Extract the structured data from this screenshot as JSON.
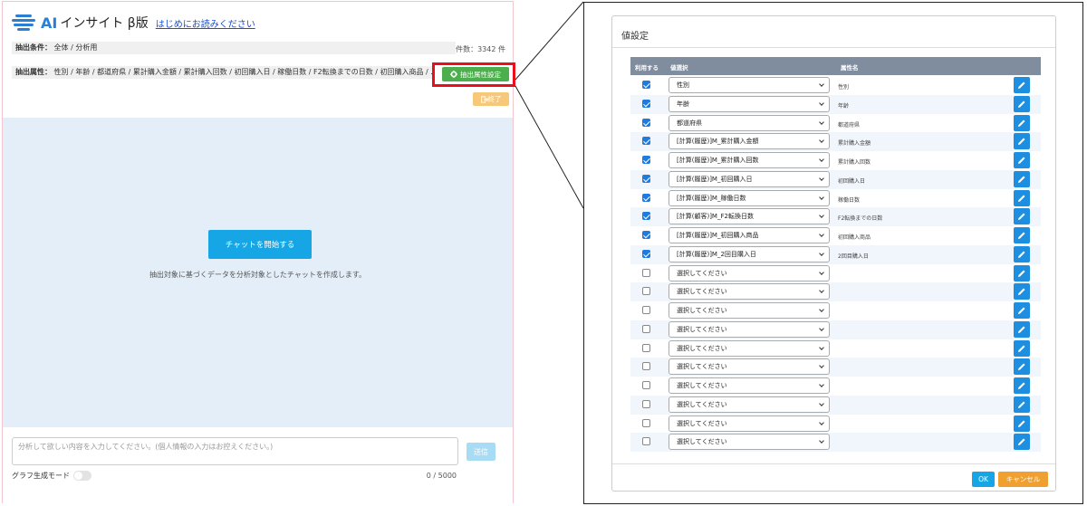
{
  "app": {
    "logo_ai": "AI",
    "logo_text": "インサイト β版",
    "readme_link": "はじめにお読みください",
    "condition_label": "抽出条件：",
    "condition_value": "全体 / 分析用",
    "count_text": "件数：3342 件",
    "attribute_label": "抽出属性：",
    "attribute_value": "性別 / 年齢 / 都道府県 / 累計購入金額 / 累計購入回数 / 初回購入日 / 稼働日数 / F2転換までの日数 / 初回購入商品 / …",
    "attribute_setting_button": "抽出属性設定",
    "end_button": "終了",
    "start_chat_button": "チャットを開始する",
    "chat_description": "抽出対象に基づくデータを分析対象としたチャットを作成します。",
    "message_placeholder": "分析して欲しい内容を入力してください。(個人情報の入力はお控えください。)",
    "send_button": "送信",
    "graph_mode_label": "グラフ生成モード",
    "char_count": "0 / 5000"
  },
  "dialog": {
    "title": "値設定",
    "headers": {
      "use": "利用する",
      "value_select": "値選択",
      "attr_name": "属性名"
    },
    "rows": [
      {
        "checked": true,
        "value": "性別",
        "attr": "性別"
      },
      {
        "checked": true,
        "value": "年齢",
        "attr": "年齢"
      },
      {
        "checked": true,
        "value": "都道府県",
        "attr": "都道府県"
      },
      {
        "checked": true,
        "value": "[計算(履歴)]M_累計購入金額",
        "attr": "累計購入金額"
      },
      {
        "checked": true,
        "value": "[計算(履歴)]M_累計購入回数",
        "attr": "累計購入回数"
      },
      {
        "checked": true,
        "value": "[計算(履歴)]M_初回購入日",
        "attr": "初回購入日"
      },
      {
        "checked": true,
        "value": "[計算(履歴)]M_稼働日数",
        "attr": "稼働日数"
      },
      {
        "checked": true,
        "value": "[計算(顧客)]M_F2転換日数",
        "attr": "F2転換までの日数"
      },
      {
        "checked": true,
        "value": "[計算(履歴)]M_初回購入商品",
        "attr": "初回購入商品"
      },
      {
        "checked": true,
        "value": "[計算(履歴)]M_2回目購入日",
        "attr": "2回目購入日"
      },
      {
        "checked": false,
        "value": "選択してください",
        "attr": ""
      },
      {
        "checked": false,
        "value": "選択してください",
        "attr": ""
      },
      {
        "checked": false,
        "value": "選択してください",
        "attr": ""
      },
      {
        "checked": false,
        "value": "選択してください",
        "attr": ""
      },
      {
        "checked": false,
        "value": "選択してください",
        "attr": ""
      },
      {
        "checked": false,
        "value": "選択してください",
        "attr": ""
      },
      {
        "checked": false,
        "value": "選択してください",
        "attr": ""
      },
      {
        "checked": false,
        "value": "選択してください",
        "attr": ""
      },
      {
        "checked": false,
        "value": "選択してください",
        "attr": ""
      },
      {
        "checked": false,
        "value": "選択してください",
        "attr": ""
      }
    ],
    "ok_button": "OK",
    "cancel_button": "キャンセル"
  },
  "colors": {
    "accent_blue": "#16a6e6",
    "green_button": "#4cae4c",
    "highlight_red": "#e8101c",
    "cancel_orange": "#f0a030"
  }
}
